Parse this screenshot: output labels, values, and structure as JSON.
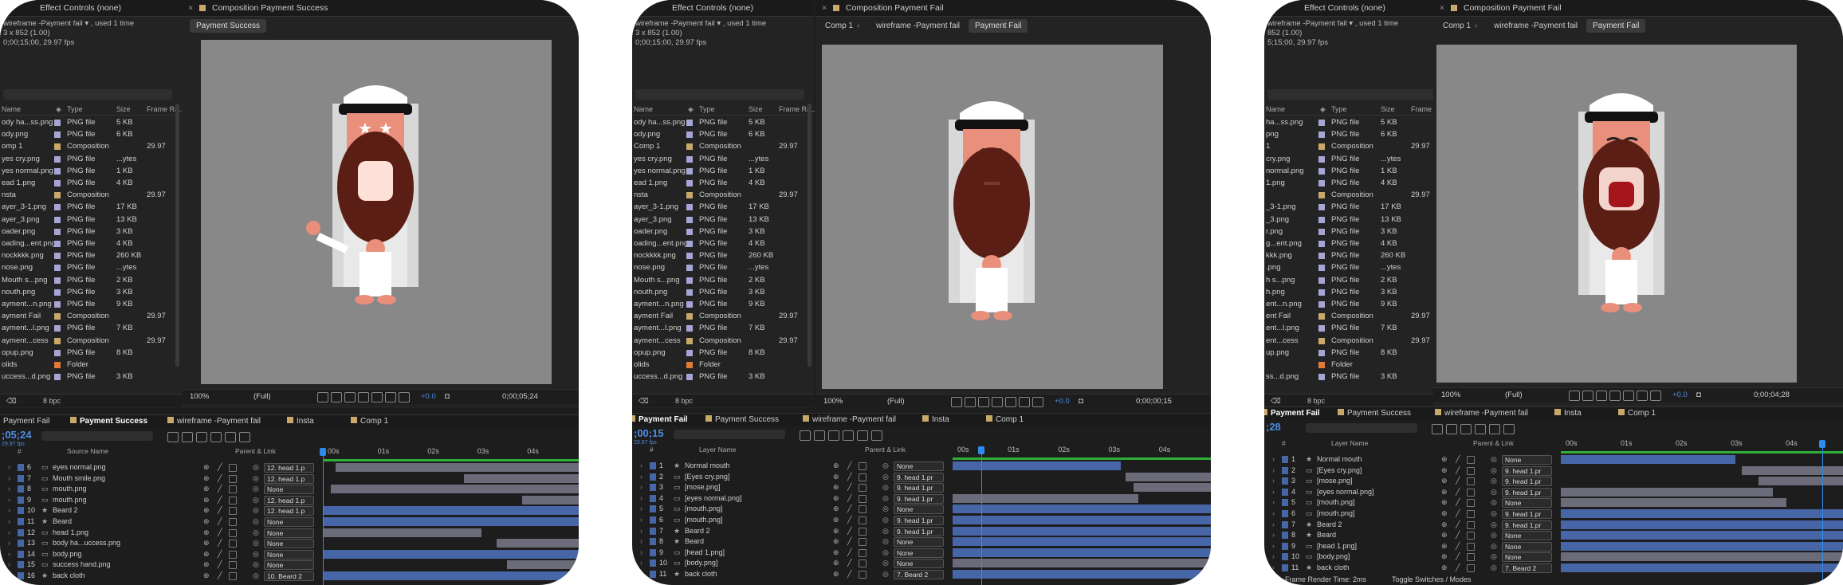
{
  "colors": {
    "accent": "#2d8ceb",
    "bar_blue": "#4766a8",
    "bar_grey": "#6b6b7a",
    "bar_green": "#2fae3a",
    "png_swatch": "#a6a6d6",
    "comp_swatch": "#c9a96a",
    "folder_swatch": "#e07a38"
  },
  "common": {
    "effect_controls": "Effect Controls (none)",
    "proj_cols": {
      "name": "Name",
      "type": "Type",
      "size": "Size",
      "rate": "Frame Ra..."
    },
    "bpc": "8 bpc",
    "zoom": "100%",
    "quality": "(Full)",
    "exposure": "+0.0",
    "tl_tabs": [
      "Payment Fail",
      "Payment Success",
      "wireframe -Payment fail",
      "Insta",
      "Comp 1"
    ],
    "ruler": [
      "00s",
      "01s",
      "02s",
      "03s",
      "04s"
    ],
    "layer_cols": {
      "num": "#",
      "name_source": "Source Name",
      "name_layer": "Layer Name",
      "parent": "Parent & Link"
    }
  },
  "panels": [
    {
      "meta": "wireframe -Payment fail ▾ , used 1 time\n3 x 852 (1.00)\n0;00;15;00, 29.97 fps",
      "viewer_title": "Composition Payment Success",
      "viewer_tab": "Payment Success",
      "timecode": "0;00;05;24",
      "tl_timecode": ";05;24",
      "tl_fps": "29.97 fps",
      "footer": "",
      "project": [
        {
          "name": "ody ha...ss.png",
          "type": "PNG file",
          "size": "5 KB",
          "rate": "",
          "kind": "png"
        },
        {
          "name": "ody.png",
          "type": "PNG file",
          "size": "6 KB",
          "rate": "",
          "kind": "png"
        },
        {
          "name": "omp 1",
          "type": "Composition",
          "size": "",
          "rate": "29.97",
          "kind": "comp"
        },
        {
          "name": "yes cry.png",
          "type": "PNG file",
          "size": "...ytes",
          "rate": "",
          "kind": "png"
        },
        {
          "name": "yes normal.png",
          "type": "PNG file",
          "size": "1 KB",
          "rate": "",
          "kind": "png"
        },
        {
          "name": "ead 1.png",
          "type": "PNG file",
          "size": "4 KB",
          "rate": "",
          "kind": "png"
        },
        {
          "name": "nsta",
          "type": "Composition",
          "size": "",
          "rate": "29.97",
          "kind": "comp"
        },
        {
          "name": "ayer_3-1.png",
          "type": "PNG file",
          "size": "17 KB",
          "rate": "",
          "kind": "png"
        },
        {
          "name": "ayer_3.png",
          "type": "PNG file",
          "size": "13 KB",
          "rate": "",
          "kind": "png"
        },
        {
          "name": "oader.png",
          "type": "PNG file",
          "size": "3 KB",
          "rate": "",
          "kind": "png"
        },
        {
          "name": "oading...ent.png",
          "type": "PNG file",
          "size": "4 KB",
          "rate": "",
          "kind": "png"
        },
        {
          "name": "nockkkk.png",
          "type": "PNG file",
          "size": "260 KB",
          "rate": "",
          "kind": "png"
        },
        {
          "name": "nose.png",
          "type": "PNG file",
          "size": "...ytes",
          "rate": "",
          "kind": "png"
        },
        {
          "name": "Mouth s...png",
          "type": "PNG file",
          "size": "2 KB",
          "rate": "",
          "kind": "png"
        },
        {
          "name": "nouth.png",
          "type": "PNG file",
          "size": "3 KB",
          "rate": "",
          "kind": "png"
        },
        {
          "name": "ayment...n.png",
          "type": "PNG file",
          "size": "9 KB",
          "rate": "",
          "kind": "png"
        },
        {
          "name": "ayment Fail",
          "type": "Composition",
          "size": "",
          "rate": "29.97",
          "kind": "comp"
        },
        {
          "name": "ayment...l.png",
          "type": "PNG file",
          "size": "7 KB",
          "rate": "",
          "kind": "png"
        },
        {
          "name": "ayment...cess",
          "type": "Composition",
          "size": "",
          "rate": "29.97",
          "kind": "comp"
        },
        {
          "name": "opup.png",
          "type": "PNG file",
          "size": "8 KB",
          "rate": "",
          "kind": "png"
        },
        {
          "name": "olids",
          "type": "Folder",
          "size": "",
          "rate": "",
          "kind": "folder"
        },
        {
          "name": "uccess...d.png",
          "type": "PNG file",
          "size": "3 KB",
          "rate": "",
          "kind": "png"
        }
      ],
      "layers": [
        {
          "num": "6",
          "name": "eyes normal.png",
          "parent": "12. head 1.p",
          "star": false
        },
        {
          "num": "7",
          "name": "Mouth smile.png",
          "parent": "12. head 1.p",
          "star": false
        },
        {
          "num": "8",
          "name": "mouth.png",
          "parent": "None",
          "star": false
        },
        {
          "num": "9",
          "name": "mouth.png",
          "parent": "12. head 1.p",
          "star": false
        },
        {
          "num": "10",
          "name": "Beard 2",
          "parent": "12. head 1.p",
          "star": true
        },
        {
          "num": "11",
          "name": "Beard",
          "parent": "None",
          "star": true
        },
        {
          "num": "12",
          "name": "head 1.png",
          "parent": "None",
          "star": false
        },
        {
          "num": "13",
          "name": "body ha...uccess.png",
          "parent": "None",
          "star": false
        },
        {
          "num": "14",
          "name": "body.png",
          "parent": "None",
          "star": false
        },
        {
          "num": "15",
          "name": "success hand.png",
          "parent": "None",
          "star": false
        },
        {
          "num": "16",
          "name": "back cloth",
          "parent": "10. Beard 2",
          "star": true
        }
      ],
      "bars": [
        [
          0,
          0.05,
          1,
          "grey"
        ],
        [
          1,
          0.55,
          1,
          "grey"
        ],
        [
          2,
          0.03,
          1,
          "grey"
        ],
        [
          3,
          0.78,
          1,
          "grey"
        ],
        [
          4,
          0,
          1,
          "blue"
        ],
        [
          5,
          0,
          1,
          "blue"
        ],
        [
          6,
          0,
          0.62,
          "grey"
        ],
        [
          7,
          0.68,
          1,
          "grey"
        ],
        [
          8,
          0,
          1,
          "blue"
        ],
        [
          9,
          0.72,
          1,
          "grey"
        ],
        [
          10,
          0,
          1,
          "blue"
        ]
      ]
    },
    {
      "meta": "wireframe -Payment fail ▾ , used 1 time\n3 x 852 (1.00)\n0;00;15;00, 29.97 fps",
      "viewer_title": "Composition Payment Fail",
      "viewer_tab": "Payment Fail",
      "crumbs": [
        "Comp 1",
        "wireframe -Payment fail"
      ],
      "timecode": "0;00;00;15",
      "tl_timecode": ";00;15",
      "tl_fps": "29.97 fps",
      "footer": "",
      "project": [
        {
          "name": "ody ha...ss.png",
          "type": "PNG file",
          "size": "5 KB",
          "rate": "",
          "kind": "png"
        },
        {
          "name": "ody.png",
          "type": "PNG file",
          "size": "6 KB",
          "rate": "",
          "kind": "png"
        },
        {
          "name": "Comp 1",
          "type": "Composition",
          "size": "",
          "rate": "29.97",
          "kind": "comp"
        },
        {
          "name": "yes cry.png",
          "type": "PNG file",
          "size": "...ytes",
          "rate": "",
          "kind": "png"
        },
        {
          "name": "yes normal.png",
          "type": "PNG file",
          "size": "1 KB",
          "rate": "",
          "kind": "png"
        },
        {
          "name": "ead 1.png",
          "type": "PNG file",
          "size": "4 KB",
          "rate": "",
          "kind": "png"
        },
        {
          "name": "nsta",
          "type": "Composition",
          "size": "",
          "rate": "29.97",
          "kind": "comp"
        },
        {
          "name": "ayer_3-1.png",
          "type": "PNG file",
          "size": "17 KB",
          "rate": "",
          "kind": "png"
        },
        {
          "name": "ayer_3.png",
          "type": "PNG file",
          "size": "13 KB",
          "rate": "",
          "kind": "png"
        },
        {
          "name": "oader.png",
          "type": "PNG file",
          "size": "3 KB",
          "rate": "",
          "kind": "png"
        },
        {
          "name": "oading...ent.png",
          "type": "PNG file",
          "size": "4 KB",
          "rate": "",
          "kind": "png"
        },
        {
          "name": "nockkkk.png",
          "type": "PNG file",
          "size": "260 KB",
          "rate": "",
          "kind": "png"
        },
        {
          "name": "nose.png",
          "type": "PNG file",
          "size": "...ytes",
          "rate": "",
          "kind": "png"
        },
        {
          "name": "Mouth s...png",
          "type": "PNG file",
          "size": "2 KB",
          "rate": "",
          "kind": "png"
        },
        {
          "name": "nouth.png",
          "type": "PNG file",
          "size": "3 KB",
          "rate": "",
          "kind": "png"
        },
        {
          "name": "ayment...n.png",
          "type": "PNG file",
          "size": "9 KB",
          "rate": "",
          "kind": "png"
        },
        {
          "name": "ayment Fail",
          "type": "Composition",
          "size": "",
          "rate": "29.97",
          "kind": "comp"
        },
        {
          "name": "ayment...l.png",
          "type": "PNG file",
          "size": "7 KB",
          "rate": "",
          "kind": "png"
        },
        {
          "name": "ayment...cess",
          "type": "Composition",
          "size": "",
          "rate": "29.97",
          "kind": "comp"
        },
        {
          "name": "opup.png",
          "type": "PNG file",
          "size": "8 KB",
          "rate": "",
          "kind": "png"
        },
        {
          "name": "olids",
          "type": "Folder",
          "size": "",
          "rate": "",
          "kind": "folder"
        },
        {
          "name": "uccess...d.png",
          "type": "PNG file",
          "size": "3 KB",
          "rate": "",
          "kind": "png"
        }
      ],
      "layers": [
        {
          "num": "1",
          "name": "Normal mouth",
          "parent": "None",
          "star": true
        },
        {
          "num": "2",
          "name": "[Eyes cry.png]",
          "parent": "9. head 1.pr",
          "star": false
        },
        {
          "num": "3",
          "name": "[mose.png]",
          "parent": "9. head 1.pr",
          "star": false
        },
        {
          "num": "4",
          "name": "[eyes normal.png]",
          "parent": "9. head 1.pr",
          "star": false
        },
        {
          "num": "5",
          "name": "[mouth.png]",
          "parent": "None",
          "star": false
        },
        {
          "num": "6",
          "name": "[mouth.png]",
          "parent": "9. head 1.pr",
          "star": false
        },
        {
          "num": "7",
          "name": "Beard 2",
          "parent": "9. head 1.pr",
          "star": true
        },
        {
          "num": "8",
          "name": "Beard",
          "parent": "None",
          "star": true
        },
        {
          "num": "9",
          "name": "[head 1.png]",
          "parent": "None",
          "star": false
        },
        {
          "num": "10",
          "name": "[body.png]",
          "parent": "None",
          "star": false
        },
        {
          "num": "11",
          "name": "back cloth",
          "parent": "7. Beard 2",
          "star": true
        }
      ],
      "bars": [
        [
          0,
          0,
          0.65,
          "blue"
        ],
        [
          1,
          0.67,
          1,
          "grey"
        ],
        [
          2,
          0.7,
          1,
          "grey"
        ],
        [
          3,
          0,
          0.72,
          "grey"
        ],
        [
          4,
          0,
          1,
          "blue"
        ],
        [
          5,
          0,
          1,
          "blue"
        ],
        [
          6,
          0,
          1,
          "blue"
        ],
        [
          7,
          0,
          1,
          "blue"
        ],
        [
          8,
          0,
          1,
          "blue"
        ],
        [
          9,
          0,
          1,
          "grey"
        ],
        [
          10,
          0,
          1,
          "blue"
        ]
      ]
    },
    {
      "meta": "wireframe -Payment fail ▾ , used 1 time\n852 (1.00)\n5;15;00, 29.97 fps",
      "viewer_title": "Composition Payment Fail",
      "viewer_tab": "Payment Fail",
      "crumbs": [
        "Comp 1",
        "wireframe -Payment fail"
      ],
      "timecode": "0;00;04;28",
      "tl_timecode": ";28",
      "tl_fps": "",
      "footer": "Frame Render Time: 2ms",
      "footer2": "Toggle Switches / Modes",
      "project": [
        {
          "name": "ha...ss.png",
          "type": "PNG file",
          "size": "5 KB",
          "rate": "",
          "kind": "png"
        },
        {
          "name": "png",
          "type": "PNG file",
          "size": "6 KB",
          "rate": "",
          "kind": "png"
        },
        {
          "name": "1",
          "type": "Composition",
          "size": "",
          "rate": "29.97",
          "kind": "comp"
        },
        {
          "name": "cry.png",
          "type": "PNG file",
          "size": "...ytes",
          "rate": "",
          "kind": "png"
        },
        {
          "name": "normal.png",
          "type": "PNG file",
          "size": "1 KB",
          "rate": "",
          "kind": "png"
        },
        {
          "name": "1.png",
          "type": "PNG file",
          "size": "4 KB",
          "rate": "",
          "kind": "png"
        },
        {
          "name": "",
          "type": "Composition",
          "size": "",
          "rate": "29.97",
          "kind": "comp"
        },
        {
          "name": "_3-1.png",
          "type": "PNG file",
          "size": "17 KB",
          "rate": "",
          "kind": "png"
        },
        {
          "name": "_3.png",
          "type": "PNG file",
          "size": "13 KB",
          "rate": "",
          "kind": "png"
        },
        {
          "name": "r.png",
          "type": "PNG file",
          "size": "3 KB",
          "rate": "",
          "kind": "png"
        },
        {
          "name": "g...ent.png",
          "type": "PNG file",
          "size": "4 KB",
          "rate": "",
          "kind": "png"
        },
        {
          "name": "kkk.png",
          "type": "PNG file",
          "size": "260 KB",
          "rate": "",
          "kind": "png"
        },
        {
          "name": ".png",
          "type": "PNG file",
          "size": "...ytes",
          "rate": "",
          "kind": "png"
        },
        {
          "name": "h s...png",
          "type": "PNG file",
          "size": "2 KB",
          "rate": "",
          "kind": "png"
        },
        {
          "name": "h.png",
          "type": "PNG file",
          "size": "3 KB",
          "rate": "",
          "kind": "png"
        },
        {
          "name": "ent...n.png",
          "type": "PNG file",
          "size": "9 KB",
          "rate": "",
          "kind": "png"
        },
        {
          "name": "ent Fail",
          "type": "Composition",
          "size": "",
          "rate": "29.97",
          "kind": "comp"
        },
        {
          "name": "ent...l.png",
          "type": "PNG file",
          "size": "7 KB",
          "rate": "",
          "kind": "png"
        },
        {
          "name": "ent...cess",
          "type": "Composition",
          "size": "",
          "rate": "29.97",
          "kind": "comp"
        },
        {
          "name": "up.png",
          "type": "PNG file",
          "size": "8 KB",
          "rate": "",
          "kind": "png"
        },
        {
          "name": "",
          "type": "Folder",
          "size": "",
          "rate": "",
          "kind": "folder"
        },
        {
          "name": "ss...d.png",
          "type": "PNG file",
          "size": "3 KB",
          "rate": "",
          "kind": "png"
        }
      ],
      "layers": [
        {
          "num": "1",
          "name": "Normal mouth",
          "parent": "None",
          "star": true
        },
        {
          "num": "2",
          "name": "[Eyes cry.png]",
          "parent": "9. head 1.pr",
          "star": false
        },
        {
          "num": "3",
          "name": "[mose.png]",
          "parent": "9. head 1.pr",
          "star": false
        },
        {
          "num": "4",
          "name": "[eyes normal.png]",
          "parent": "9. head 1.pr",
          "star": false
        },
        {
          "num": "5",
          "name": "[mouth.png]",
          "parent": "None",
          "star": false
        },
        {
          "num": "6",
          "name": "[mouth.png]",
          "parent": "9. head 1.pr",
          "star": false
        },
        {
          "num": "7",
          "name": "Beard 2",
          "parent": "9. head 1.pr",
          "star": true
        },
        {
          "num": "8",
          "name": "Beard",
          "parent": "None",
          "star": true
        },
        {
          "num": "9",
          "name": "[head 1.png]",
          "parent": "None",
          "star": false
        },
        {
          "num": "10",
          "name": "[body.png]",
          "parent": "None",
          "star": false
        },
        {
          "num": "11",
          "name": "back cloth",
          "parent": "7. Beard 2",
          "star": true
        }
      ],
      "bars": [
        [
          0,
          0,
          0.62,
          "blue"
        ],
        [
          1,
          0.64,
          1,
          "grey"
        ],
        [
          2,
          0.7,
          1,
          "grey"
        ],
        [
          3,
          0,
          0.75,
          "grey"
        ],
        [
          4,
          0,
          0.8,
          "grey"
        ],
        [
          5,
          0,
          1,
          "blue"
        ],
        [
          6,
          0,
          1,
          "blue"
        ],
        [
          7,
          0,
          1,
          "blue"
        ],
        [
          8,
          0,
          1,
          "blue"
        ],
        [
          9,
          0,
          1,
          "grey"
        ],
        [
          10,
          0,
          1,
          "blue"
        ]
      ]
    }
  ]
}
